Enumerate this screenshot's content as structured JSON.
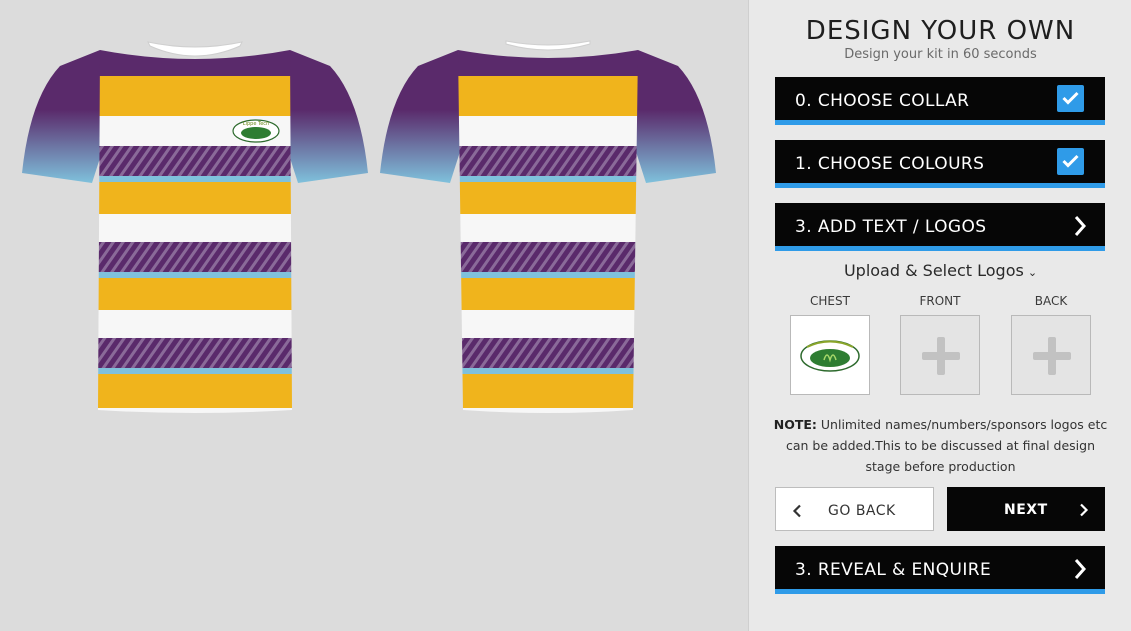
{
  "kit": {
    "colors": {
      "purple": "#5a2a6b",
      "yellow": "#f0b41c",
      "white": "#f7f7f7",
      "sky": "#7fc1dc",
      "accent": "#2f9be8"
    },
    "views": [
      "front",
      "back"
    ],
    "chest_logo_text": "Lippe Tech"
  },
  "panel": {
    "title": "DESIGN YOUR OWN",
    "subtitle": "Design your kit in 60 seconds",
    "steps": [
      {
        "label": "0. CHOOSE COLLAR",
        "state": "checked",
        "icon": "checkbox-checked-icon"
      },
      {
        "label": "1. CHOOSE COLOURS",
        "state": "checked",
        "icon": "checkbox-checked-icon"
      },
      {
        "label": "3. ADD TEXT / LOGOS",
        "state": "active",
        "icon": "chevron-right-icon"
      }
    ],
    "upload": {
      "title": "Upload & Select Logos",
      "caret": "⌄",
      "slots": [
        {
          "label": "CHEST",
          "filled": true
        },
        {
          "label": "FRONT",
          "filled": false
        },
        {
          "label": "BACK",
          "filled": false
        }
      ]
    },
    "note": {
      "prefix": "NOTE:",
      "text": " Unlimited names/numbers/sponsors logos etc can be added.This to be discussed at final design stage before production"
    },
    "buttons": {
      "back": "GO BACK",
      "next": "NEXT"
    },
    "final_step": {
      "label": "3. REVEAL & ENQUIRE",
      "icon": "chevron-right-icon"
    }
  }
}
